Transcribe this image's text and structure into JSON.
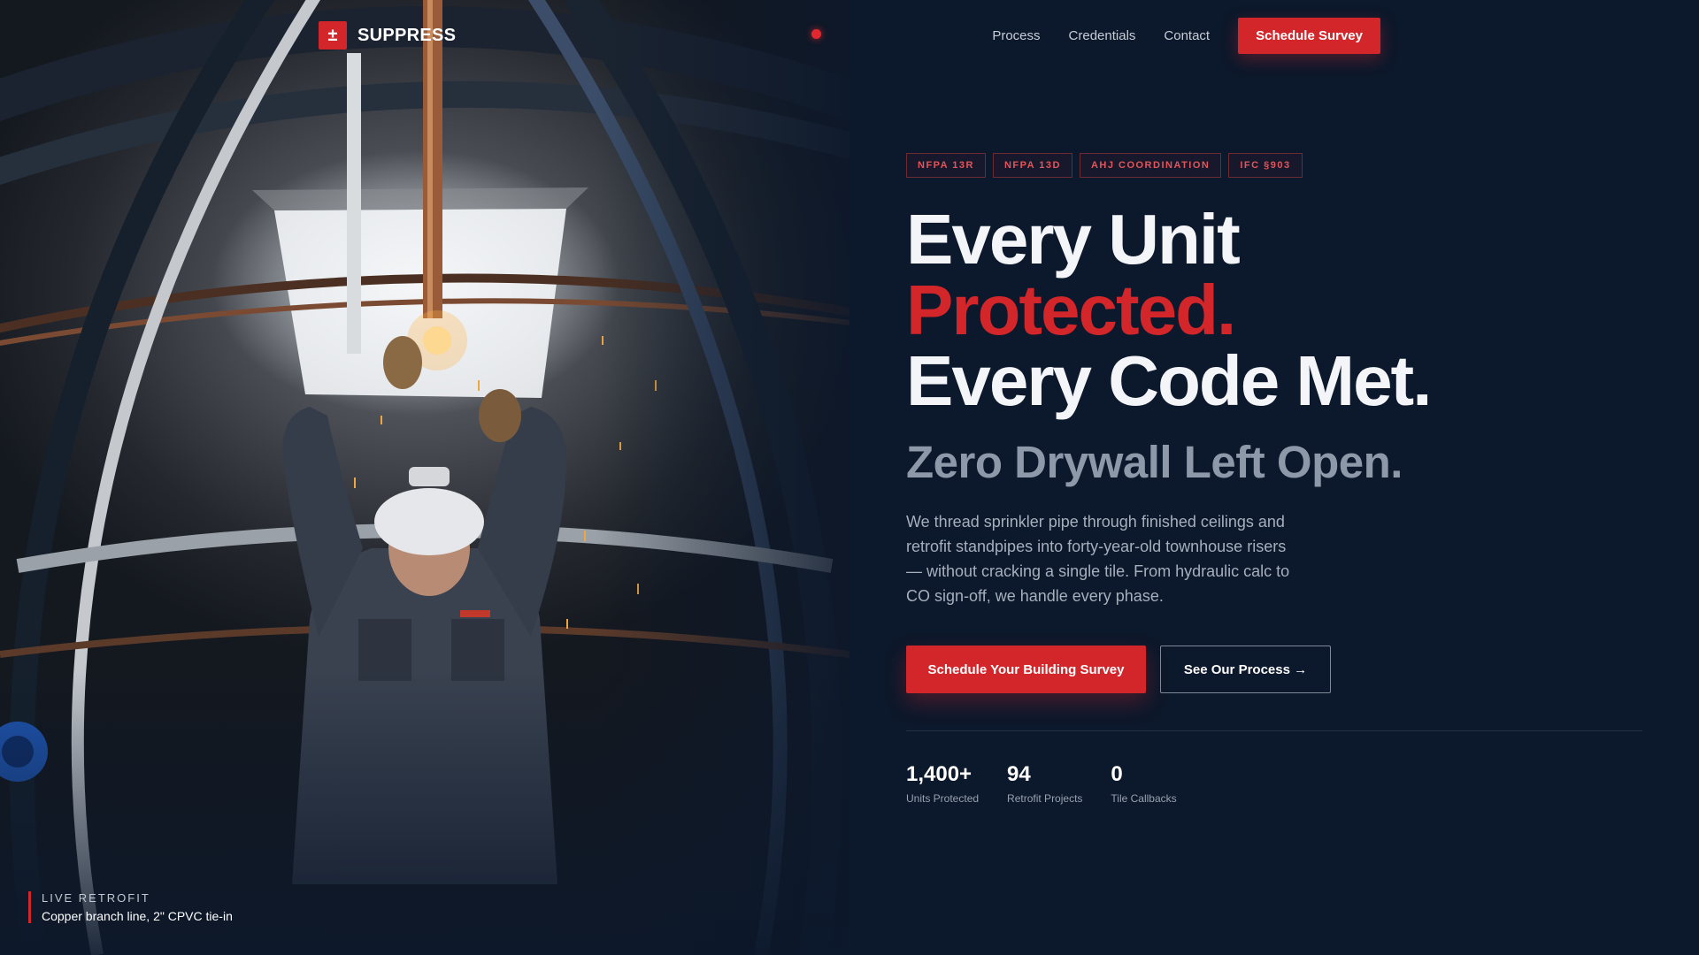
{
  "brand": {
    "name": "SUPPRESS",
    "logo_glyph": "±",
    "accent_color": "#d3262b",
    "background_color": "#0c182b"
  },
  "nav": {
    "links": [
      "Process",
      "Credentials",
      "Contact"
    ],
    "cta_label": "Schedule Survey"
  },
  "hero": {
    "tags": [
      "NFPA 13R",
      "NFPA 13D",
      "AHJ COORDINATION",
      "IFC §903"
    ],
    "headline_line1": "Every Unit",
    "headline_line2": "Protected.",
    "headline_line3": "Every Code Met.",
    "subheadline": "Zero Drywall Left Open.",
    "body": "We thread sprinkler pipe through finished ceilings and retrofit standpipes into forty-year-old townhouse risers — without cracking a single tile. From hydraulic calc to CO sign-off, we handle every phase.",
    "primary_cta": "Schedule Your Building Survey",
    "secondary_cta": "See Our Process →"
  },
  "stats": [
    {
      "value": "1,400+",
      "label": "Units Protected"
    },
    {
      "value": "94",
      "label": "Retrofit Projects"
    },
    {
      "value": "0",
      "label": "Tile Callbacks"
    }
  ],
  "photo_caption": {
    "kicker": "LIVE RETROFIT",
    "text": "Copper branch line, 2\" CPVC tie-in"
  }
}
